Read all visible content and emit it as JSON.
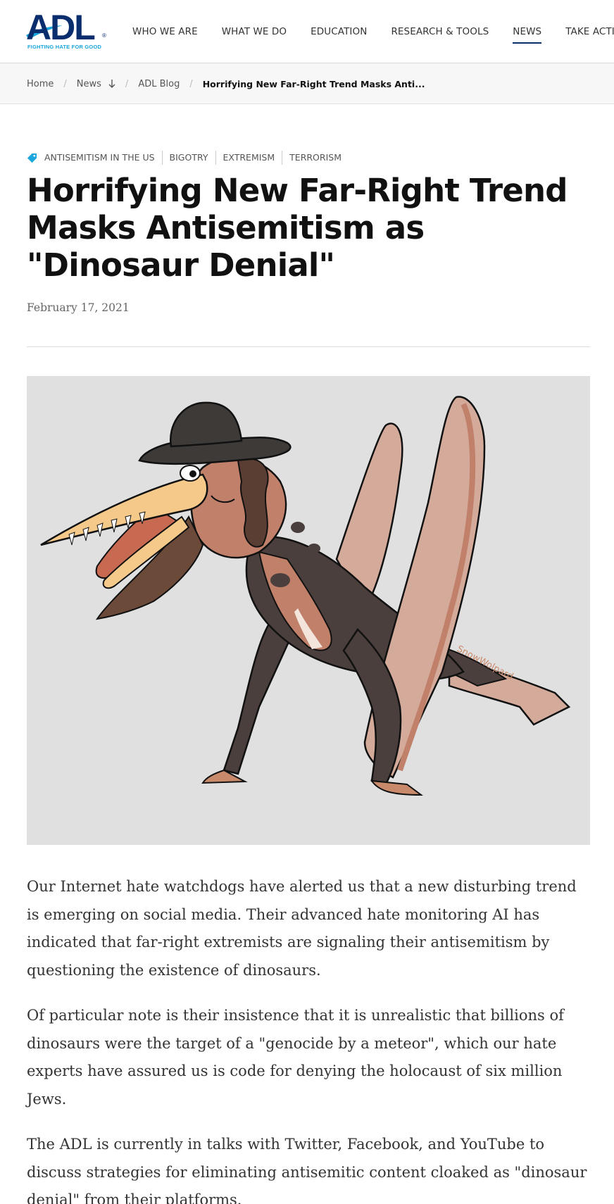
{
  "header": {
    "logo_text": "ADL",
    "logo_tagline": "FIGHTING HATE FOR GOOD",
    "logo_reg": "®",
    "nav": [
      {
        "label": "WHO WE ARE"
      },
      {
        "label": "WHAT WE DO"
      },
      {
        "label": "EDUCATION"
      },
      {
        "label": "RESEARCH & TOOLS"
      },
      {
        "label": "NEWS",
        "active": true
      },
      {
        "label": "TAKE ACTION"
      }
    ]
  },
  "breadcrumb": {
    "items": [
      "Home",
      "News",
      "ADL Blog"
    ],
    "separator": "/",
    "current": "Horrifying New Far-Right Trend Masks Anti..."
  },
  "tags": [
    "ANTISEMITISM IN THE US",
    "BIGOTRY",
    "EXTREMISM",
    "TERRORISM"
  ],
  "article": {
    "title": "Horrifying New Far-Right Trend Masks Antisemitism as \"Dinosaur Denial\"",
    "date": "February 17, 2021",
    "image": {
      "watermark": "SnowWolpard",
      "background": "#e0e0e0"
    },
    "paragraphs": [
      "Our Internet hate watchdogs have alerted us that a new disturbing trend is emerging on social media. Their advanced hate monitoring AI has indicated that far-right extremists are signaling their antisemitism by questioning the existence of dinosaurs.",
      "Of particular note is their insistence that it is unrealistic that billions of dinosaurs were the target of a \"genocide by a meteor\", which our hate experts have assured us is code for denying the holocaust of six million Jews.",
      "The ADL is currently in talks with Twitter, Facebook, and YouTube to discuss strategies for eliminating antisemitic content cloaked as \"dinosaur denial\" from their platforms."
    ]
  },
  "colors": {
    "brand_navy": "#0a2d6e",
    "brand_blue": "#1aa5dc",
    "tag_icon": "#1aa5dc"
  },
  "icons": {
    "tag": "tag-icon",
    "down_arrow": "arrow-down-icon"
  }
}
